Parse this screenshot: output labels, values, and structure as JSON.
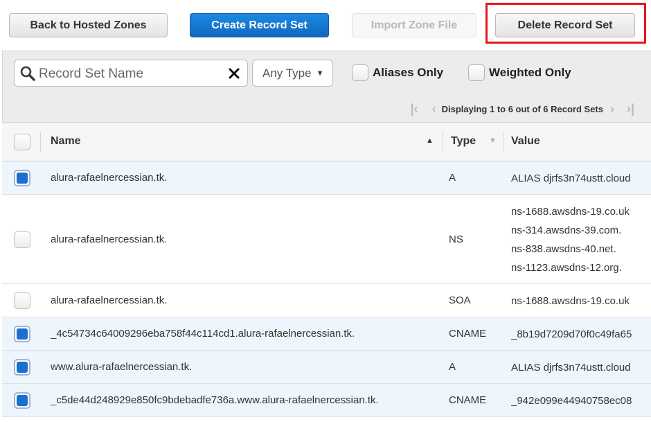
{
  "toolbar": {
    "back_label": "Back to Hosted Zones",
    "create_label": "Create Record Set",
    "import_label": "Import Zone File",
    "delete_label": "Delete Record Set"
  },
  "filter": {
    "search_placeholder": "Record Set Name",
    "type_select": "Any Type",
    "aliases_only_label": "Aliases Only",
    "weighted_only_label": "Weighted Only",
    "pager_text": "Displaying 1 to 6 out of 6 Record Sets"
  },
  "table": {
    "columns": {
      "name": "Name",
      "type": "Type",
      "value": "Value"
    },
    "rows": [
      {
        "selected": true,
        "name": "alura-rafaelnercessian.tk.",
        "type": "A",
        "value": [
          "ALIAS djrfs3n74ustt.cloud"
        ]
      },
      {
        "selected": false,
        "name": "alura-rafaelnercessian.tk.",
        "type": "NS",
        "value": [
          "ns-1688.awsdns-19.co.uk",
          "ns-314.awsdns-39.com.",
          "ns-838.awsdns-40.net.",
          "ns-1123.awsdns-12.org."
        ]
      },
      {
        "selected": false,
        "name": "alura-rafaelnercessian.tk.",
        "type": "SOA",
        "value": [
          "ns-1688.awsdns-19.co.uk"
        ]
      },
      {
        "selected": true,
        "name": "_4c54734c64009296eba758f44c114cd1.alura-rafaelnercessian.tk.",
        "type": "CNAME",
        "value": [
          "_8b19d7209d70f0c49fa65"
        ]
      },
      {
        "selected": true,
        "name": "www.alura-rafaelnercessian.tk.",
        "type": "A",
        "value": [
          "ALIAS djrfs3n74ustt.cloud"
        ]
      },
      {
        "selected": true,
        "name": "_c5de44d248929e850fc9bdebadfe736a.www.alura-rafaelnercessian.tk.",
        "type": "CNAME",
        "value": [
          "_942e099e44940758ec08"
        ]
      }
    ]
  },
  "colors": {
    "primary": "#1a6fcf",
    "highlight_border": "#e8141c",
    "selected_row": "#eef5fd"
  }
}
